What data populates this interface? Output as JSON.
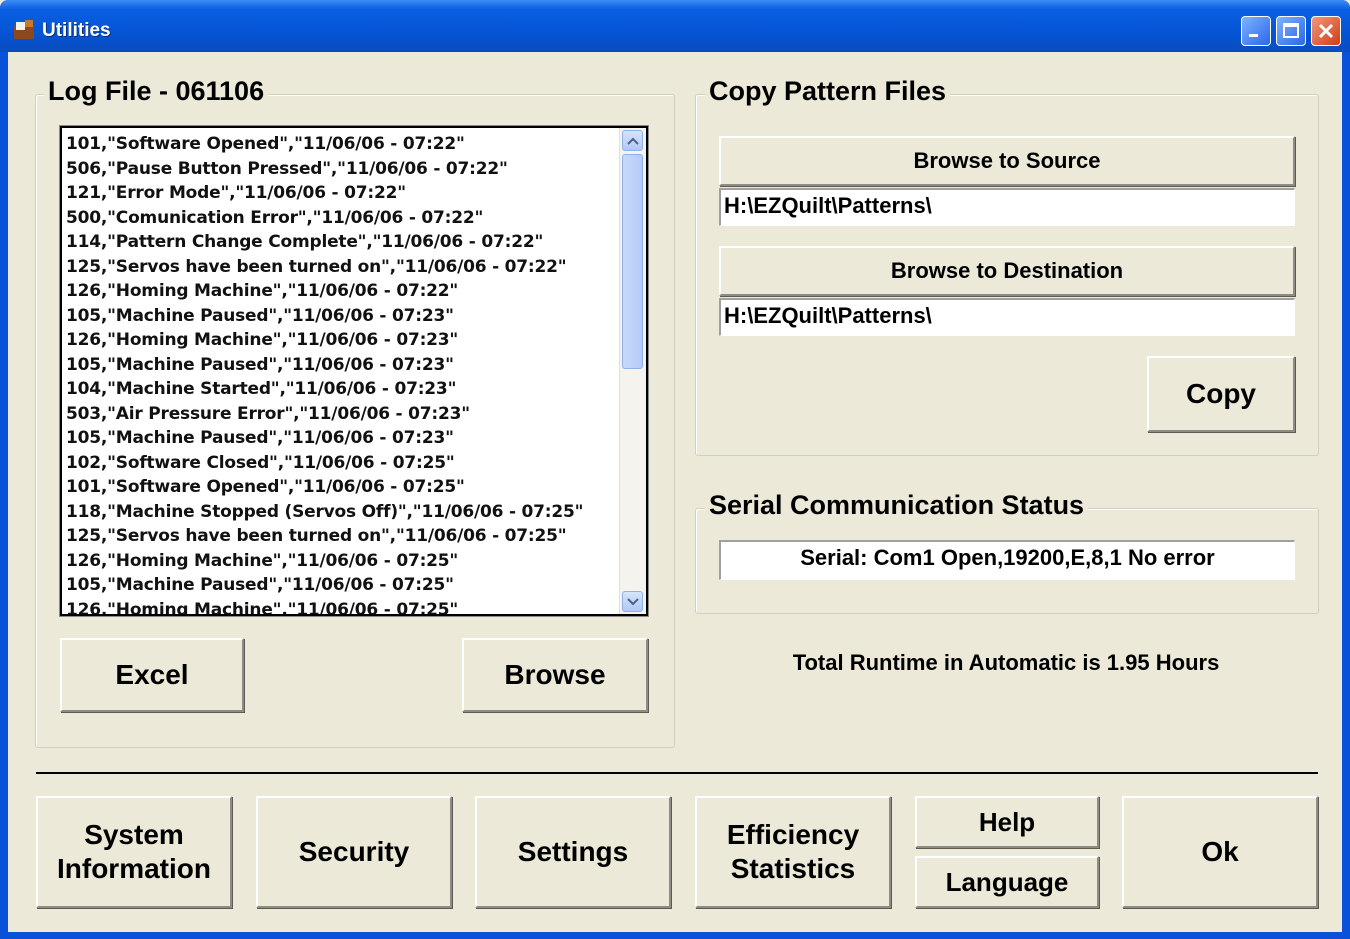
{
  "window": {
    "title": "Utilities"
  },
  "log": {
    "title": "Log File - 061106",
    "entries": [
      "101,\"Software Opened\",\"11/06/06 - 07:22\"",
      "506,\"Pause Button Pressed\",\"11/06/06 - 07:22\"",
      "121,\"Error Mode\",\"11/06/06 - 07:22\"",
      "500,\"Comunication Error\",\"11/06/06 - 07:22\"",
      "114,\"Pattern Change Complete\",\"11/06/06 - 07:22\"",
      "125,\"Servos have been turned on\",\"11/06/06 - 07:22\"",
      "126,\"Homing Machine\",\"11/06/06 - 07:22\"",
      "105,\"Machine Paused\",\"11/06/06 - 07:23\"",
      "126,\"Homing Machine\",\"11/06/06 - 07:23\"",
      "105,\"Machine Paused\",\"11/06/06 - 07:23\"",
      "104,\"Machine Started\",\"11/06/06 - 07:23\"",
      "503,\"Air Pressure Error\",\"11/06/06 - 07:23\"",
      "105,\"Machine Paused\",\"11/06/06 - 07:23\"",
      "102,\"Software Closed\",\"11/06/06 - 07:25\"",
      "101,\"Software Opened\",\"11/06/06 - 07:25\"",
      "118,\"Machine Stopped (Servos Off)\",\"11/06/06 - 07:25\"",
      "125,\"Servos have been turned on\",\"11/06/06 - 07:25\"",
      "126,\"Homing Machine\",\"11/06/06 - 07:25\"",
      "105,\"Machine Paused\",\"11/06/06 - 07:25\"",
      "126,\"Homing Machine\",\"11/06/06 - 07:25\""
    ],
    "excel_label": "Excel",
    "browse_label": "Browse"
  },
  "copy": {
    "title": "Copy Pattern Files",
    "browse_source_label": "Browse to Source",
    "source_path": "H:\\EZQuilt\\Patterns\\",
    "browse_destination_label": "Browse to Destination",
    "destination_path": "H:\\EZQuilt\\Patterns\\",
    "copy_label": "Copy"
  },
  "serial": {
    "title": "Serial Communication Status",
    "status": "Serial: Com1 Open,19200,E,8,1  No error"
  },
  "runtime_text": "Total Runtime in Automatic is 1.95 Hours",
  "bottom": {
    "system_info_line1": "System",
    "system_info_line2": "Information",
    "security": "Security",
    "settings": "Settings",
    "efficiency_line1": "Efficiency",
    "efficiency_line2": "Statistics",
    "help": "Help",
    "language": "Language",
    "ok": "Ok"
  }
}
